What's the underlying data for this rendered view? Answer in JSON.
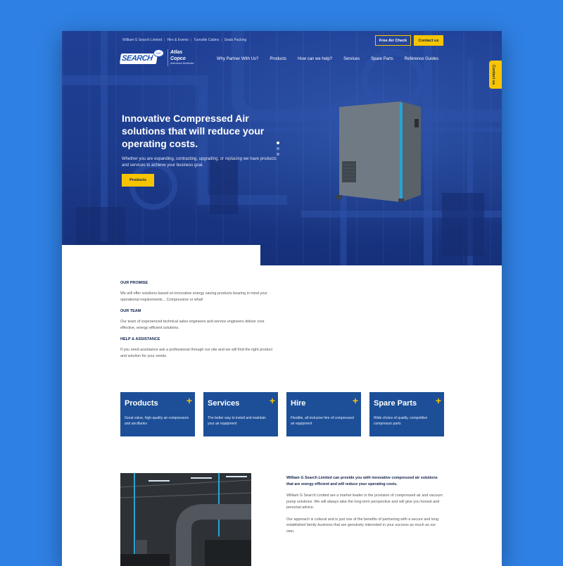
{
  "topbar": {
    "links": [
      "William G Search Limited",
      "Hire & Events",
      "Turnstile Cabins",
      "Seals Packing"
    ],
    "free_air_check": "Free Air Check",
    "contact_us": "Contact us"
  },
  "logo": {
    "search": "SEARCH",
    "badge": "1947",
    "atlas": "Atlas Copco",
    "atlas_sub": "Authorised Distributor"
  },
  "nav": [
    "Why Partner With Us?",
    "Products",
    "How can we help?",
    "Services",
    "Spare Parts",
    "Reference Guides"
  ],
  "contact_tab": "Contact us",
  "hero": {
    "title": "Innovative Compressed Air solutions that will reduce your operating costs.",
    "subtitle": "Whether you are expanding, contracting, upgrading, or replacing we have products and services to achieve your business goal.",
    "button": "Products",
    "slides_total": 3,
    "slide_active": 1
  },
  "info": {
    "promise_title": "OUR PROMISE",
    "promise_text": "We will offer solutions based on innovative energy saving products bearing in mind your operational requirements... Compressive or what!",
    "team_title": "OUR TEAM",
    "team_text": "Our team of experienced technical sales engineers and service engineers deliver cost effective, energy efficient solutions.",
    "help_title": "HELP & ASSISTANCE",
    "help_text": "If you need assistance ask a professional through our site and we will find the right product and solution for your needs."
  },
  "cards": [
    {
      "title": "Products",
      "desc": "Great value, high-quality air compressors and ancillaries"
    },
    {
      "title": "Services",
      "desc": "The better way to install and maintain your air equipment"
    },
    {
      "title": "Hire",
      "desc": "Flexible, all-inclusive hire of compressed air equipment"
    },
    {
      "title": "Spare Parts",
      "desc": "Wide choice of quality, competitive compressor parts"
    }
  ],
  "about": {
    "lead": "William G Search Limited can provide you with innovative compressed air solutions that are energy efficient and will reduce your operating costs.",
    "p1": "William G Search Limited are a market leader in the provision of compressed air and vacuum pump solutions. We will always take the long term perspective and will give you honest and personal advice.",
    "p2": "Our approach is cultural and is just one of the benefits of partnering with a secure and long established family business that are genuinely interested in your success as much as our own."
  },
  "colors": {
    "background": "#2f80e4",
    "hero": "#1f3f95",
    "accent_yellow": "#f7c500",
    "card_blue": "#1c4f98"
  }
}
